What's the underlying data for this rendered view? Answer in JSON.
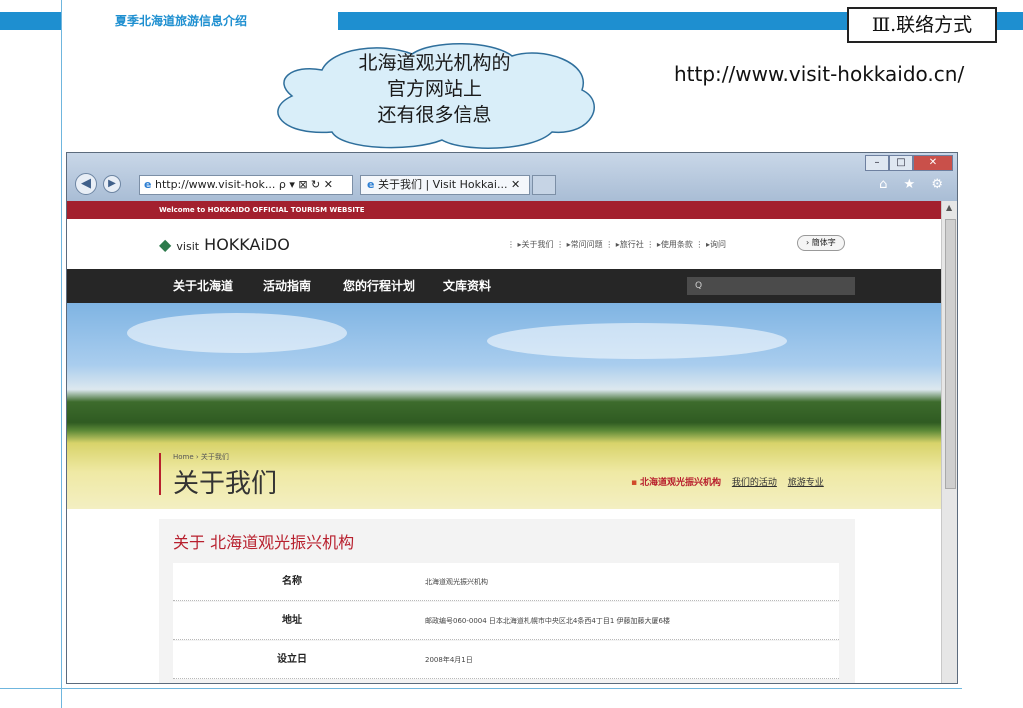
{
  "slide": {
    "header_title": "夏季北海道旅游信息介绍",
    "section_label": "Ⅲ.联络方式",
    "callout_lines": [
      "北海道观光机构的",
      "官方网站上",
      "还有很多信息"
    ],
    "website_url": "http://www.visit-hokkaido.cn/"
  },
  "browser": {
    "address_text": "http://www.visit-hok...",
    "address_controls": "ρ ▾ ⊠ ↻ ✕",
    "tab_label": "关于我们 | Visit Hokkai...",
    "tab_close": "✕",
    "window_buttons": [
      "–",
      "□",
      "✕"
    ],
    "toolbar_icons": "⌂ ★ ⚙",
    "scroll_up": "▲"
  },
  "site": {
    "welcome": "Welcome to HOKKAIDO OFFICIAL TOURISM WEBSITE",
    "logo_prefix": "visit",
    "logo_text": "HOKKAiDO",
    "top_links": "⋮ ▸关于我们 ⋮ ▸常问问题 ⋮ ▸旅行社 ⋮ ▸使用条款 ⋮ ▸询问",
    "lang_button": "› 簡体字",
    "menu": [
      "关于北海道",
      "活动指南",
      "您的行程计划",
      "文库资料"
    ],
    "search_placeholder": "Q",
    "breadcrumb": "Home › 关于我们",
    "page_title": "关于我们",
    "subnav": {
      "active": "北海道观光振兴机构",
      "links": [
        "我们的活动",
        "旅游专业"
      ]
    },
    "section_title": "关于 北海道观光振兴机构",
    "rows": [
      {
        "label": "名称",
        "value": "北海道观光振兴机构"
      },
      {
        "label": "地址",
        "value": "邮政编号060-0004 日本北海道札幌市中央区北4条西4丁目1 伊藤加藤大厦6楼"
      },
      {
        "label": "设立日",
        "value": "2008年4月1日"
      }
    ]
  },
  "colors": {
    "slide_band": "#1e8fd0",
    "site_red": "#a3202e",
    "menu_bg": "#262626"
  }
}
